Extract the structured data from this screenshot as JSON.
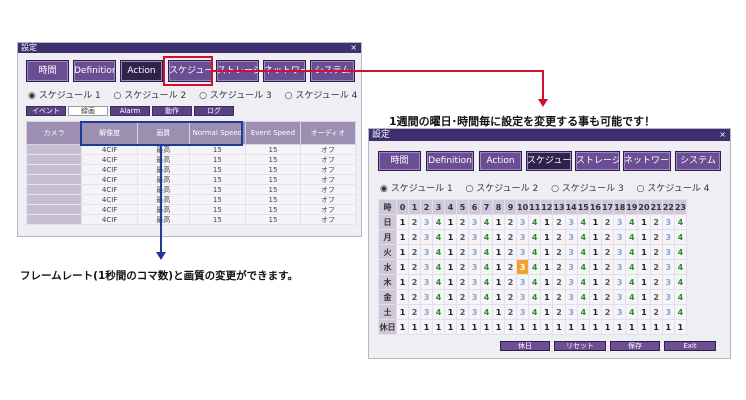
{
  "left": {
    "title": "設定",
    "close": "×",
    "tabs": [
      "時間",
      "Definition",
      "Action",
      "スケジュール",
      "ストレージ",
      "ネットワーク",
      "システム"
    ],
    "radios": [
      "◉ スケジュール 1",
      "○ スケジュール 2",
      "○ スケジュール 3",
      "○ スケジュール 4"
    ],
    "subtabs": [
      "イベント",
      "録画",
      "Alarm",
      "動作",
      "ログ"
    ],
    "columns": [
      "カメラ",
      "解像度",
      "画質",
      "Normal Speed",
      "Event Speed",
      "オーディオ"
    ],
    "row": {
      "resolution": "4CIF",
      "quality": "最高",
      "normal": "15",
      "event": "15",
      "audio": "オフ"
    },
    "row_count": 8
  },
  "right": {
    "title": "設定",
    "close": "×",
    "tabs": [
      "時間",
      "Definition",
      "Action",
      "スケジュール",
      "ストレージ",
      "ネットワーク",
      "システム"
    ],
    "radios": [
      "◉ スケジュール 1",
      "○ スケジュール 2",
      "○ スケジュール 3",
      "○ スケジュール 4"
    ],
    "hour_label": "時",
    "hours": [
      "0",
      "1",
      "2",
      "3",
      "4",
      "5",
      "6",
      "7",
      "8",
      "9",
      "10",
      "11",
      "12",
      "13",
      "14",
      "15",
      "16",
      "17",
      "18",
      "19",
      "20",
      "21",
      "22",
      "23"
    ],
    "days": [
      "日",
      "月",
      "火",
      "水",
      "木",
      "金",
      "土",
      "休日"
    ],
    "pattern": [
      "1",
      "2",
      "3",
      "4"
    ],
    "holiday_value": "1",
    "highlight": {
      "day_index": 3,
      "hour": 10
    },
    "buttons": [
      "休日",
      "リセット",
      "保存",
      "Exit"
    ]
  },
  "captions": {
    "top": "1週間の曜日･時間毎に設定を変更する事も可能です！",
    "bottom": "フレームレート(1秒間のコマ数)と画質の変更ができます。"
  },
  "colors": {
    "callout_red": "#d0102d",
    "callout_blue": "#1c3c96",
    "title_bar": "#3e2f6e",
    "highlight": "#f2a12b"
  }
}
